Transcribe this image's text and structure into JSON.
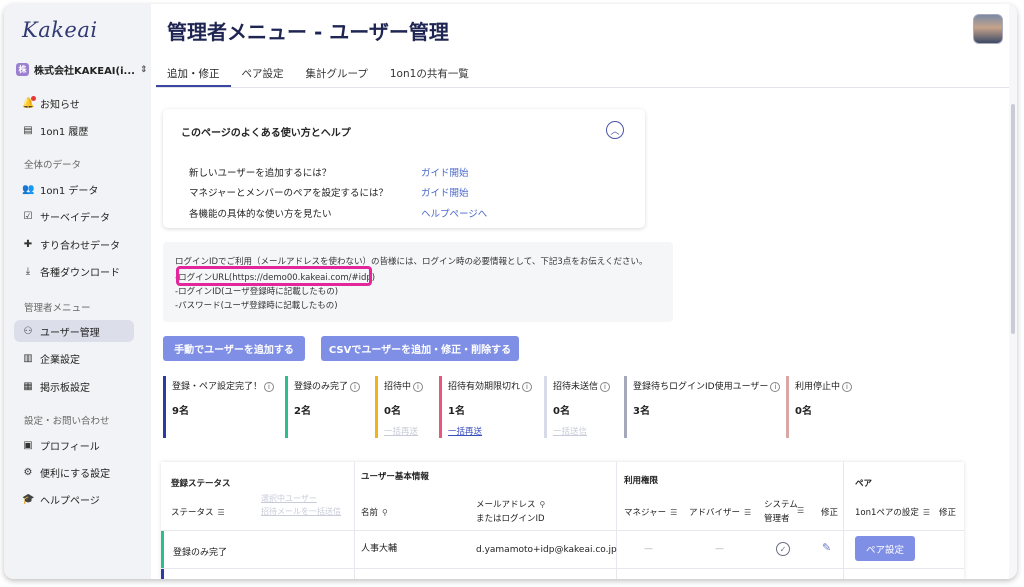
{
  "sidebar": {
    "logo": "Kakeai",
    "company": "株式会社KAKEAI(i...",
    "company_badge": "株",
    "items_top": [
      {
        "label": "お知らせ",
        "icon": "bell-icon"
      },
      {
        "label": "1on1 履歴",
        "icon": "history-icon"
      }
    ],
    "section_data": "全体のデータ",
    "items_data": [
      {
        "label": "1on1 データ",
        "icon": "people-icon"
      },
      {
        "label": "サーベイデータ",
        "icon": "survey-icon"
      },
      {
        "label": "すり合わせデータ",
        "icon": "puzzle-icon"
      },
      {
        "label": "各種ダウンロード",
        "icon": "download-icon"
      }
    ],
    "section_admin": "管理者メニュー",
    "items_admin": [
      {
        "label": "ユーザー管理",
        "icon": "user-manage-icon"
      },
      {
        "label": "企業設定",
        "icon": "building-icon"
      },
      {
        "label": "掲示板設定",
        "icon": "board-icon"
      }
    ],
    "section_settings": "設定・お問い合わせ",
    "items_settings": [
      {
        "label": "プロフィール",
        "icon": "profile-icon"
      },
      {
        "label": "便利にする設定",
        "icon": "gear-icon"
      },
      {
        "label": "ヘルプページ",
        "icon": "graduation-icon"
      }
    ]
  },
  "header": {
    "title": "管理者メニュー - ユーザー管理"
  },
  "tabs": [
    {
      "label": "追加・修正"
    },
    {
      "label": "ペア設定"
    },
    {
      "label": "集計グループ"
    },
    {
      "label": "1on1の共有一覧"
    }
  ],
  "help": {
    "title": "このページのよくある使い方とヘルプ",
    "rows": [
      {
        "text": "新しいユーザーを追加するには？",
        "link": "ガイド開始"
      },
      {
        "text": "マネジャーとメンバーのペアを設定するには？",
        "link": "ガイド開始"
      },
      {
        "text": "各機能の具体的な使い方を見たい",
        "link": "ヘルプページへ"
      }
    ]
  },
  "info": {
    "line1": "ログインIDでご利用（メールアドレスを使わない）の皆様には、ログイン時の必要情報として、下記3点をお伝えください。",
    "line2": "-ログインURL(https://demo00.kakeai.com/#idp)",
    "line3": "-ログインID(ユーザ登録時に記載したもの)",
    "line4": "-パスワード(ユーザ登録時に記載したもの)"
  },
  "buttons": {
    "add_manual": "手動でユーザーを追加する",
    "csv": "CSVでユーザーを追加・修正・削除する"
  },
  "stats": [
    {
      "label": "登録・ペア設定完了！",
      "value": "9名",
      "color": "#2b3aa6",
      "action": ""
    },
    {
      "label": "登録のみ完了",
      "value": "2名",
      "color": "#2dbf8a",
      "action": ""
    },
    {
      "label": "招待中",
      "value": "0名",
      "color": "#f2b21a",
      "action": "一括再送"
    },
    {
      "label": "招待有効期限切れ",
      "value": "1名",
      "color": "#e8587a",
      "action": "一括再送"
    },
    {
      "label": "招待未送信",
      "value": "0名",
      "color": "#d7dbe8",
      "action": "一括送信"
    },
    {
      "label": "登録待ちログインID使用ユーザー",
      "value": "3名",
      "color": "#a4a8b8",
      "action": ""
    },
    {
      "label": "利用停止中",
      "value": "0名",
      "color": "#d8a8a4",
      "action": ""
    }
  ],
  "table": {
    "group_status": "登録ステータス",
    "group_basic": "ユーザー基本情報",
    "group_perm": "利用権限",
    "group_pair": "ペア",
    "col_status": "ステータス",
    "link_select": "選択中ユーザー",
    "link_resend": "招待メールを一括送信",
    "col_name": "名前",
    "col_email_1": "メールアドレス",
    "col_email_2": "またはログインID",
    "col_manager": "マネジャー",
    "col_advisor": "アドバイザー",
    "col_sys_1": "システム",
    "col_sys_2": "管理者",
    "col_edit": "修正",
    "col_pair_setting": "1on1ペアの設定",
    "col_pair_edit": "修正",
    "row": {
      "status": "登録のみ完了",
      "name": "人事大輔",
      "email": "d.yamamoto+idp@kakeai.co.jp",
      "manager": "—",
      "advisor": "—",
      "pair_button": "ペア設定"
    }
  }
}
